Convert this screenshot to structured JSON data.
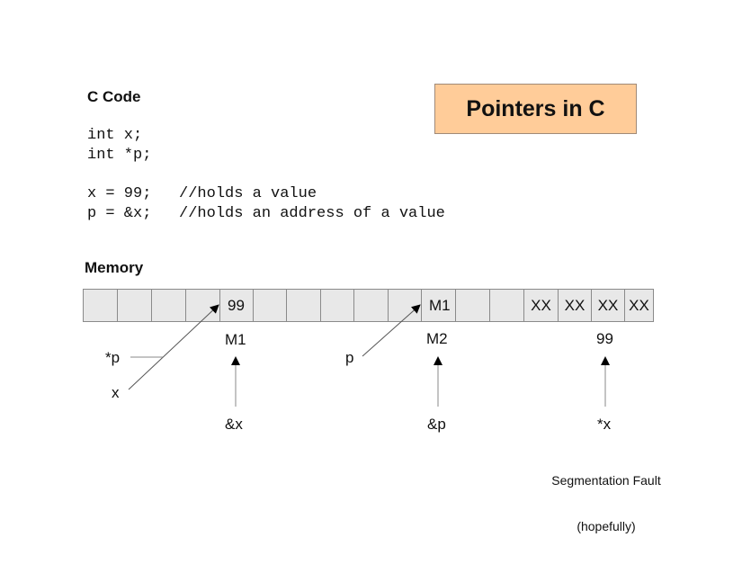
{
  "title": "Pointers in C",
  "code_section": {
    "heading": "C Code",
    "lines": [
      "int x;",
      "int *p;",
      "",
      "x = 99;   //holds a value",
      "p = &x;   //holds an address of a value"
    ]
  },
  "memory_section": {
    "heading": "Memory",
    "cells": [
      "",
      "",
      "",
      "",
      "99",
      "",
      "",
      "",
      "",
      "",
      "M1",
      "",
      "",
      "XX",
      "XX",
      "XX",
      "XX"
    ]
  },
  "annotations": {
    "star_p": "*p",
    "x": "x",
    "addr_m1": "M1",
    "amp_x": "&x",
    "p": "p",
    "addr_m2": "M2",
    "amp_p": "&p",
    "value_99": "99",
    "star_x": "*x",
    "segfault_line1": "Segmentation Fault",
    "segfault_line2": "(hopefully)"
  },
  "colors": {
    "title_fill": "#ffcc99",
    "cell_fill": "#e8e8e8"
  }
}
